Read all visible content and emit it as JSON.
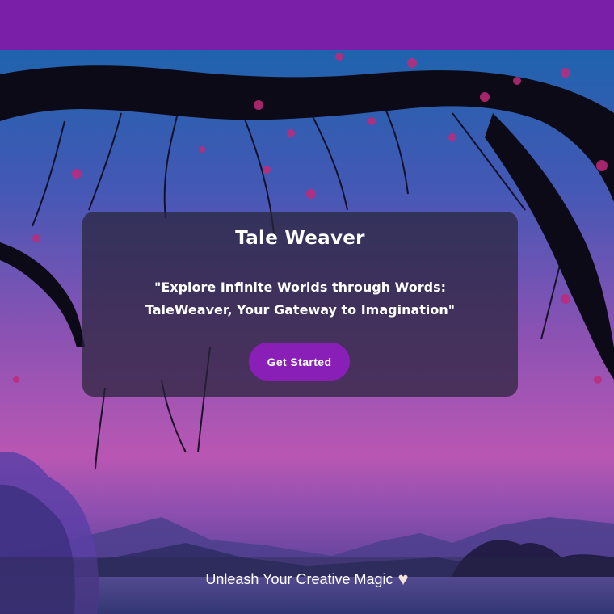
{
  "header": {
    "color": "#7a1fa8"
  },
  "hero": {
    "title": "Tale Weaver",
    "tagline_line1": "\"Explore Infinite Worlds through Words:",
    "tagline_line2": "TaleWeaver, Your Gateway to Imagination\"",
    "cta_label": "Get Started",
    "cta_color": "#8a1fb8"
  },
  "footer": {
    "text": "Unleash Your Creative Magic",
    "icon": "heart-icon"
  },
  "background": {
    "description_icon": "lake-sunset-tree-background"
  }
}
